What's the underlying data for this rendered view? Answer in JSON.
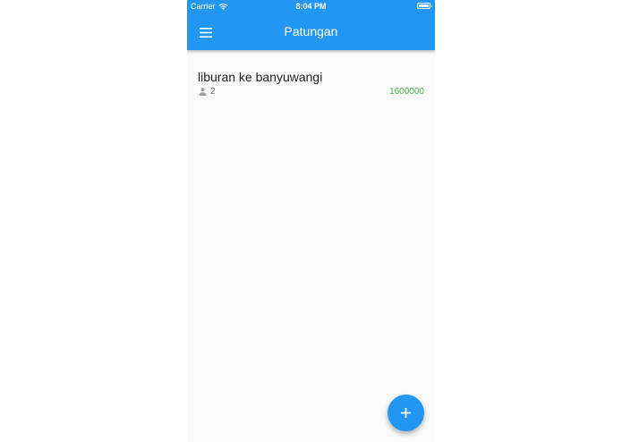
{
  "status_bar": {
    "carrier": "Carrier",
    "time": "8:04 PM"
  },
  "app_bar": {
    "title": "Patungan",
    "menu_icon": "menu-icon"
  },
  "list": {
    "items": [
      {
        "title": "liburan ke banyuwangi",
        "members": "2",
        "member_icon": "person-icon",
        "amount": "1600000"
      }
    ]
  },
  "fab": {
    "icon": "plus-icon"
  },
  "colors": {
    "primary": "#2196f3",
    "amount": "#4caf50",
    "background": "#fafafa"
  }
}
